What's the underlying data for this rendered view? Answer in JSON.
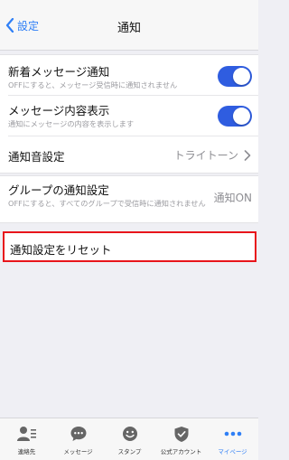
{
  "navbar": {
    "back_label": "設定",
    "title": "通知"
  },
  "settings": {
    "new_message": {
      "title": "新着メッセージ通知",
      "subtitle": "OFFにすると、メッセージ受信時に通知されません",
      "enabled": true
    },
    "message_preview": {
      "title": "メッセージ内容表示",
      "subtitle": "通知にメッセージの内容を表示します",
      "enabled": true
    },
    "sound": {
      "title": "通知音設定",
      "value": "トライトーン"
    },
    "group": {
      "title": "グループの通知設定",
      "subtitle": "OFFにすると、すべてのグループで受信時に通知されません",
      "value": "通知ON"
    },
    "reset": {
      "title": "通知設定をリセット"
    }
  },
  "tabbar": {
    "items": [
      {
        "label": "連絡先",
        "icon": "contacts-icon"
      },
      {
        "label": "メッセージ",
        "icon": "chat-bubble-icon"
      },
      {
        "label": "スタンプ",
        "icon": "smiley-icon"
      },
      {
        "label": "公式アカウント",
        "icon": "verified-shield-icon"
      },
      {
        "label": "マイページ",
        "icon": "more-dots-icon"
      }
    ],
    "active": "マイページ"
  },
  "colors": {
    "accent": "#2f7ff6",
    "toggle_on": "#2f5de0",
    "highlight": "#e8151b"
  }
}
